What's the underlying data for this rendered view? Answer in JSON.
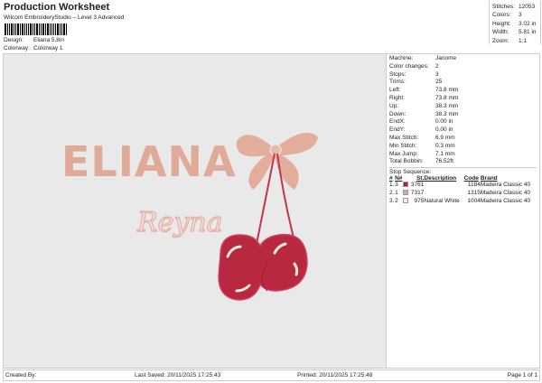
{
  "header": {
    "title": "Production Worksheet",
    "subtitle": "Wilcom EmbroideryStudio – Level 3 Advanced",
    "design_label": "Design:",
    "design": "Eliana 5,8in",
    "colorway_label": "Colorway:",
    "colorway": "Colorway 1"
  },
  "stats": [
    {
      "k": "Stitches:",
      "v": "12053"
    },
    {
      "k": "Colors:",
      "v": "3"
    },
    {
      "k": "Height:",
      "v": "3.02 in"
    },
    {
      "k": "Width:",
      "v": "5.81 in"
    },
    {
      "k": "Zoom:",
      "v": "1:1"
    }
  ],
  "artwork": {
    "name": "ELIANA",
    "script": "Reyna"
  },
  "details": [
    {
      "k": "Machine:",
      "v": "Janome"
    },
    {
      "k": "Color changes:",
      "v": "2"
    },
    {
      "k": "Stops:",
      "v": "3"
    },
    {
      "k": "Trims:",
      "v": "25"
    },
    {
      "k": "Left:",
      "v": "73.8 mm"
    },
    {
      "k": "Right:",
      "v": "73.8 mm"
    },
    {
      "k": "Up:",
      "v": "38.3 mm"
    },
    {
      "k": "Down:",
      "v": "38.3 mm"
    },
    {
      "k": "EndX:",
      "v": "0.00 in"
    },
    {
      "k": "EndY:",
      "v": "0.00 in"
    },
    {
      "k": "Max Stitch:",
      "v": "6.9 mm"
    },
    {
      "k": "Min Stitch:",
      "v": "0.3 mm"
    },
    {
      "k": "Max Jump:",
      "v": "7.1 mm"
    },
    {
      "k": "Total Bobbin:",
      "v": "76.52ft"
    }
  ],
  "stop_sequence": {
    "title": "Stop Sequence:",
    "headers": [
      "#",
      "N#",
      "St.",
      "Description",
      "Code",
      "Brand"
    ],
    "rows": [
      {
        "n": "1.",
        "num": "3",
        "color": "#c0183c",
        "st": "3761",
        "desc": "",
        "code": "1184",
        "brand": "Madeira Classic 40"
      },
      {
        "n": "2.",
        "num": "1",
        "color": "#e8a0a8",
        "st": "7317",
        "desc": "",
        "code": "1315",
        "brand": "Madeira Classic 40"
      },
      {
        "n": "3.",
        "num": "2",
        "color": "#f2f0ec",
        "st": "975",
        "desc": "Natural White",
        "code": "1004",
        "brand": "Madeira Classic 40"
      }
    ]
  },
  "footer": {
    "created": "Created By:",
    "saved": "Last Saved: 20/11/2025 17:25:43",
    "printed": "Printed: 20/11/2025 17:25:48",
    "page": "Page 1 of 1"
  }
}
